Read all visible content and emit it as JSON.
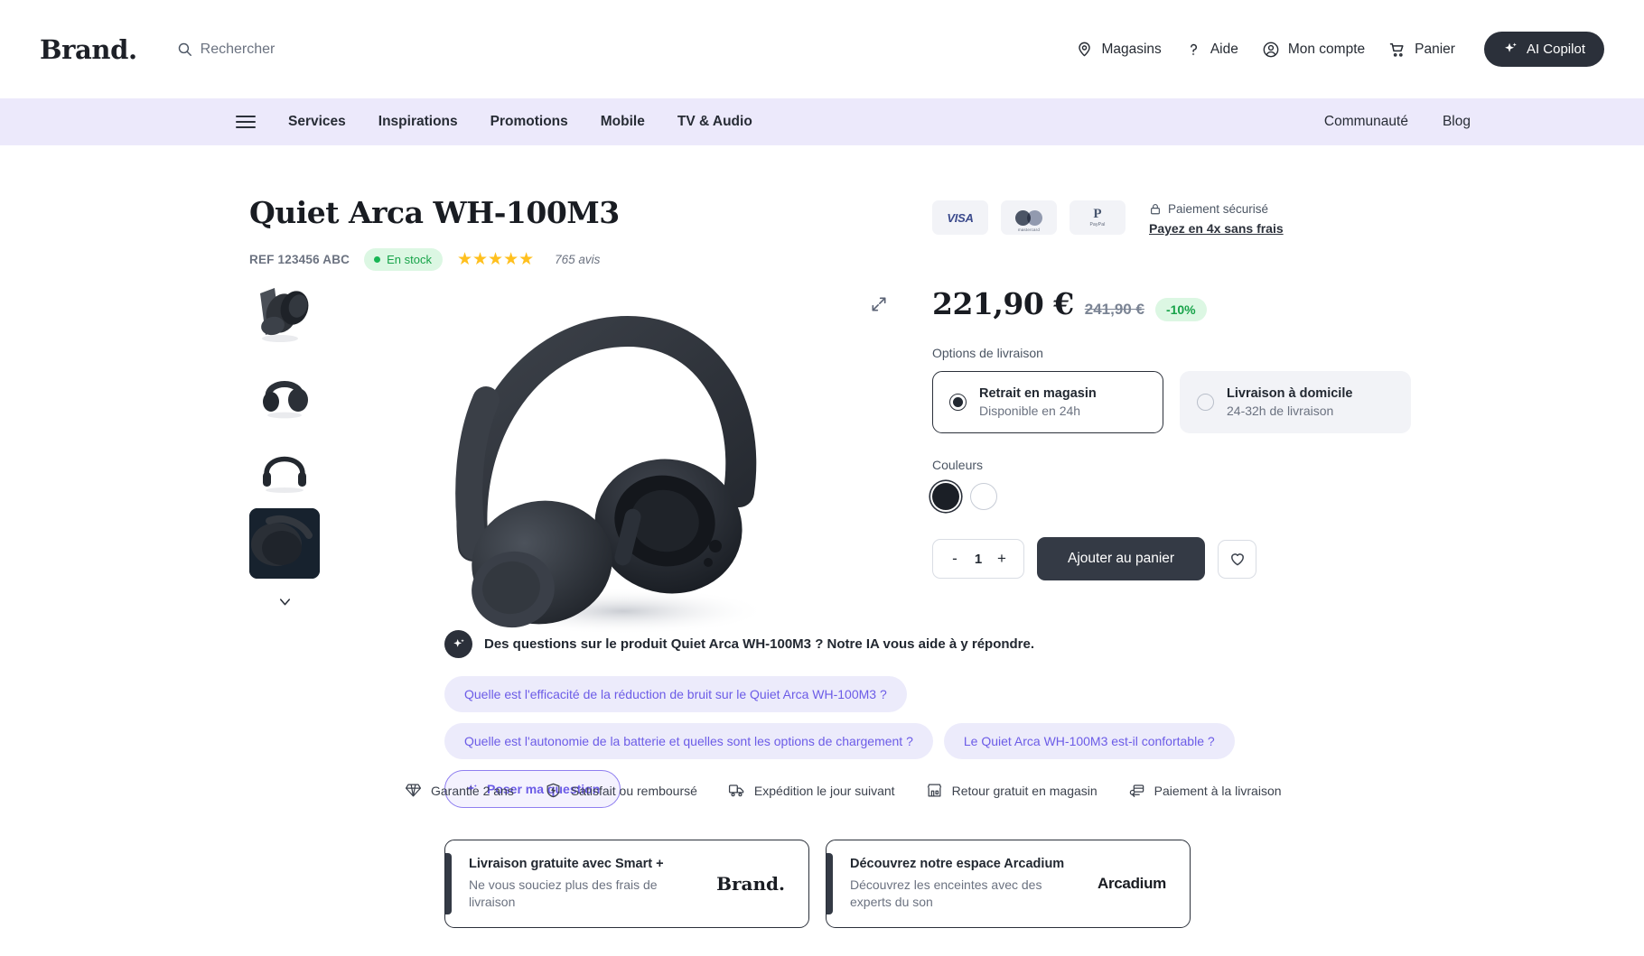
{
  "header": {
    "logo": "Brand.",
    "search_placeholder": "Rechercher",
    "utils": [
      {
        "label": "Magasins",
        "icon": "location-pin-icon"
      },
      {
        "label": "Aide",
        "icon": "question-mark-icon"
      },
      {
        "label": "Mon compte",
        "icon": "user-circle-icon"
      },
      {
        "label": "Panier",
        "icon": "shopping-cart-icon"
      }
    ],
    "copilot_label": "AI Copilot"
  },
  "nav": {
    "links": [
      "Services",
      "Inspirations",
      "Promotions",
      "Mobile",
      "TV & Audio"
    ],
    "right_links": [
      "Communauté",
      "Blog"
    ],
    "bar_color": "#ece9fb"
  },
  "product": {
    "title": "Quiet Arca WH-100M3",
    "ref": "REF 123456 ABC",
    "stock_label": "En stock",
    "stars": "★★★★★",
    "reviews": "765 avis",
    "thumbnails": [
      {
        "name": "thumbnail-1-angled-closeup"
      },
      {
        "name": "thumbnail-2-front"
      },
      {
        "name": "thumbnail-3-front-wide"
      },
      {
        "name": "thumbnail-4-dark-detail"
      }
    ],
    "gallery_more_icon": "chevron-down-icon",
    "expand_icon": "expand-arrows-icon"
  },
  "payment": {
    "cards": [
      "VISA",
      "mastercard",
      "PayPal"
    ],
    "secure_label": "Paiement sécurisé",
    "installment_link": "Payez en 4x sans frais"
  },
  "price": {
    "current": "221,90 €",
    "old": "241,90 €",
    "discount": "-10%",
    "accent_green": "#17a349",
    "badge_bg": "#dcf7e3"
  },
  "delivery": {
    "label": "Options de livraison",
    "options": [
      {
        "title": "Retrait en magasin",
        "sub": "Disponible en 24h",
        "selected": true
      },
      {
        "title": "Livraison à domicile",
        "sub": "24-32h de livraison",
        "selected": false
      }
    ]
  },
  "colors": {
    "label": "Couleurs",
    "swatches": [
      {
        "name": "color-swatch-black",
        "hex": "#1b1f26",
        "selected": true
      },
      {
        "name": "color-swatch-white",
        "hex": "#ffffff",
        "selected": false
      }
    ]
  },
  "cart": {
    "minus": "-",
    "quantity": "1",
    "plus": "+",
    "add_label": "Ajouter au panier",
    "wishlist_icon": "heart-icon"
  },
  "ai": {
    "prompt_prefix": "Des questions sur le produit ",
    "prompt_product": "Quiet Arca WH-100M3",
    "prompt_suffix": " ? Notre IA vous aide à y répondre.",
    "suggestions": [
      "Quelle est l'efficacité de la réduction de bruit sur le Quiet Arca WH-100M3 ?",
      "Quelle est l'autonomie de la batterie et quelles sont les options de chargement ?",
      "Le Quiet Arca WH-100M3 est-il confortable ?"
    ],
    "ask_label": "Poser ma question",
    "accent": "#6c5ce7"
  },
  "benefits": [
    {
      "label": "Garantie 2 ans",
      "icon": "diamond-icon"
    },
    {
      "label": "Satisfait ou remboursé",
      "icon": "money-back-icon"
    },
    {
      "label": "Expédition le jour suivant",
      "icon": "delivery-truck-icon"
    },
    {
      "label": "Retour gratuit en magasin",
      "icon": "store-icon"
    },
    {
      "label": "Paiement à la livraison",
      "icon": "card-payment-icon"
    }
  ],
  "banners": [
    {
      "title": "Livraison gratuite avec Smart +",
      "sub": "Ne vous souciez plus des frais de livraison",
      "logo": "Brand.",
      "logo_style": "serif"
    },
    {
      "title": "Découvrez notre espace Arcadium",
      "sub": "Découvrez les enceintes avec des experts du son",
      "logo": "Arcadium",
      "logo_style": "sans"
    }
  ]
}
